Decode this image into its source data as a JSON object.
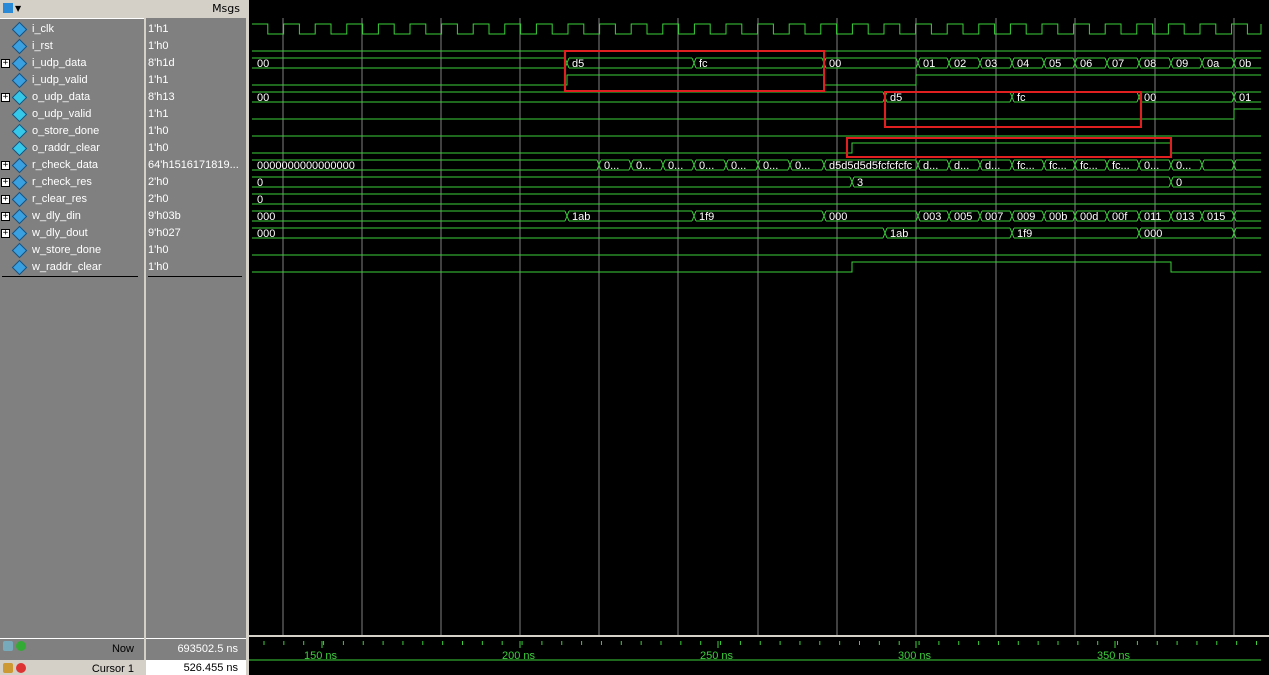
{
  "header": {
    "msgs_label": "Msgs"
  },
  "signals": [
    {
      "name": "i_clk",
      "value": "1'h1",
      "expand": false,
      "dir": "in"
    },
    {
      "name": "i_rst",
      "value": "1'h0",
      "expand": false,
      "dir": "in"
    },
    {
      "name": "i_udp_data",
      "value": "8'h1d",
      "expand": true,
      "dir": "in"
    },
    {
      "name": "i_udp_valid",
      "value": "1'h1",
      "expand": false,
      "dir": "in"
    },
    {
      "name": "o_udp_data",
      "value": "8'h13",
      "expand": true,
      "dir": "out"
    },
    {
      "name": "o_udp_valid",
      "value": "1'h1",
      "expand": false,
      "dir": "out"
    },
    {
      "name": "o_store_done",
      "value": "1'h0",
      "expand": false,
      "dir": "out"
    },
    {
      "name": "o_raddr_clear",
      "value": "1'h0",
      "expand": false,
      "dir": "out"
    },
    {
      "name": "r_check_data",
      "value": "64'h1516171819...",
      "expand": true,
      "dir": "in"
    },
    {
      "name": "r_check_res",
      "value": "2'h0",
      "expand": true,
      "dir": "in"
    },
    {
      "name": "r_clear_res",
      "value": "2'h0",
      "expand": true,
      "dir": "in"
    },
    {
      "name": "w_dly_din",
      "value": "9'h03b",
      "expand": true,
      "dir": "in"
    },
    {
      "name": "w_dly_dout",
      "value": "9'h027",
      "expand": true,
      "dir": "in"
    },
    {
      "name": "w_store_done",
      "value": "1'h0",
      "expand": false,
      "dir": "in"
    },
    {
      "name": "w_raddr_clear",
      "value": "1'h0",
      "expand": false,
      "dir": "in"
    }
  ],
  "bus_labels": {
    "i_udp_data": [
      "00",
      "d5",
      "fc",
      "00",
      "01",
      "02",
      "03",
      "04",
      "05",
      "06",
      "07",
      "08",
      "09",
      "0a",
      "0b"
    ],
    "o_udp_data": [
      "00",
      "d5",
      "fc",
      "00",
      "01"
    ],
    "r_check_data": [
      "0000000000000000",
      "0...",
      "0...",
      "0...",
      "0...",
      "0...",
      "0...",
      "0...",
      "d5d5d5d5fcfcfcfc",
      "d...",
      "d...",
      "d...",
      "fc...",
      "fc...",
      "fc...",
      "fc...",
      "0...",
      "0..."
    ],
    "r_check_res": [
      "0",
      "3",
      "0"
    ],
    "r_clear_res": [
      "0"
    ],
    "w_dly_din": [
      "000",
      "1ab",
      "1f9",
      "000",
      "003",
      "005",
      "007",
      "009",
      "00b",
      "00d",
      "00f",
      "011",
      "013",
      "015"
    ],
    "w_dly_dout": [
      "000",
      "1ab",
      "1f9",
      "000"
    ]
  },
  "timeline": {
    "ticks": [
      "150 ns",
      "200 ns",
      "250 ns",
      "300 ns",
      "350 ns"
    ]
  },
  "status": {
    "now_label": "Now",
    "now_value": "693502.5 ns",
    "cursor_label": "Cursor 1",
    "cursor_value": "526.455 ns"
  },
  "colors": {
    "wave": "#3cd03c",
    "highlight": "#e02020",
    "grid": "#808080",
    "pane": "#808080"
  }
}
